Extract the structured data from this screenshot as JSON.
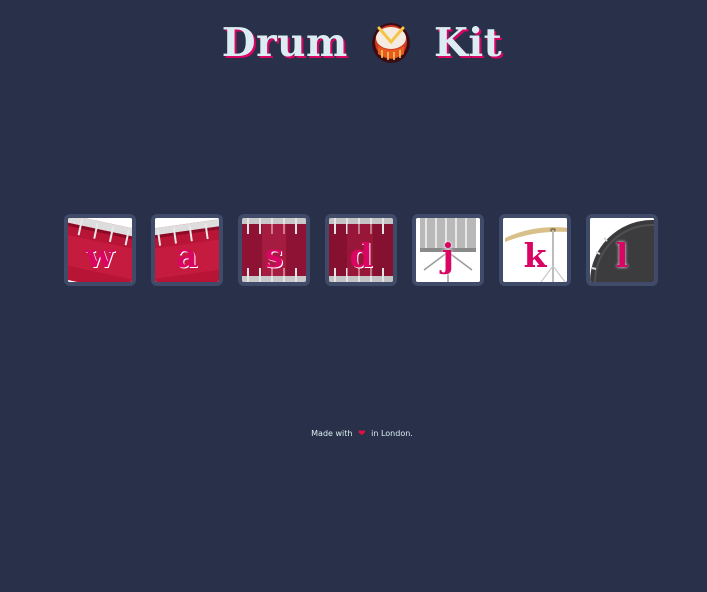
{
  "header": {
    "title_left": "Drum",
    "title_icon": "drum-icon",
    "title_right": "Kit"
  },
  "keys": [
    {
      "letter": "w",
      "art": "red-drum-tilted"
    },
    {
      "letter": "a",
      "art": "red-drum-tilted"
    },
    {
      "letter": "s",
      "art": "red-drum-front"
    },
    {
      "letter": "d",
      "art": "red-drum-front"
    },
    {
      "letter": "j",
      "art": "snare-drum"
    },
    {
      "letter": "k",
      "art": "crash-cymbal"
    },
    {
      "letter": "l",
      "art": "kick-drum"
    }
  ],
  "footer": {
    "before": "Made with",
    "heart_icon": "heart-icon",
    "after": "in London."
  },
  "colors": {
    "background": "#283149",
    "key_border": "#404b69",
    "accent": "#da0463",
    "text": "#dbedf3"
  }
}
